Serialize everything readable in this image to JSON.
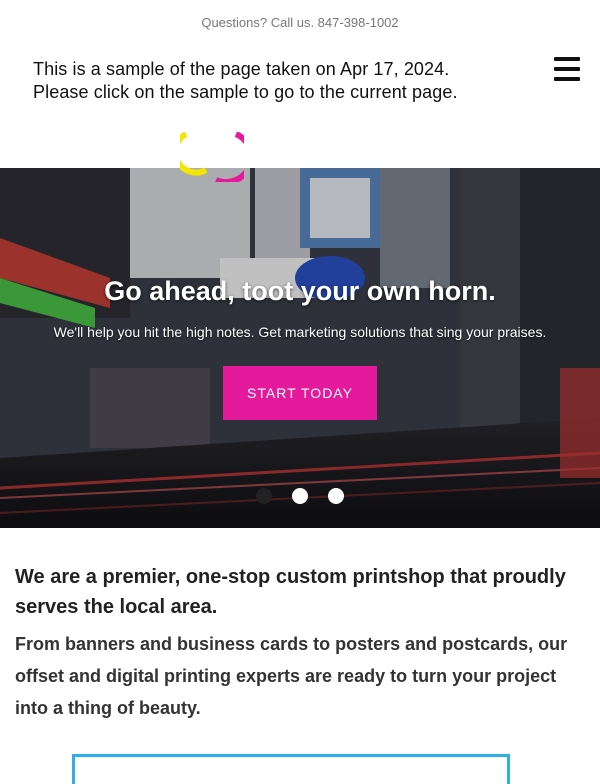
{
  "topbar": {
    "phone_text": "Questions? Call us. 847-398-1002"
  },
  "notice": {
    "line1": "This is a sample of the page taken on Apr 17, 2024.",
    "line2": "Please click on the sample to go to the current page."
  },
  "icons": {
    "menu": "hamburger-menu-icon",
    "logo": "logo-mark"
  },
  "hero": {
    "title": "Go ahead, toot your own horn.",
    "subtitle": "We'll help you hit the high notes. Get marketing solutions that sing your praises.",
    "cta_label": "START TODAY",
    "slide_dots": 3,
    "active_slide": 1
  },
  "intro": {
    "headline": "We are a premier, one-stop custom printshop that proudly serves the local area.",
    "body": "From banners and business cards to posters and postcards, our offset and digital printing experts are ready to turn your project into a thing of beauty."
  },
  "colors": {
    "accent": "#e5199b",
    "logo_yellow": "#f2e600",
    "logo_magenta": "#e5199b",
    "box_border": "#2bb1e6"
  }
}
